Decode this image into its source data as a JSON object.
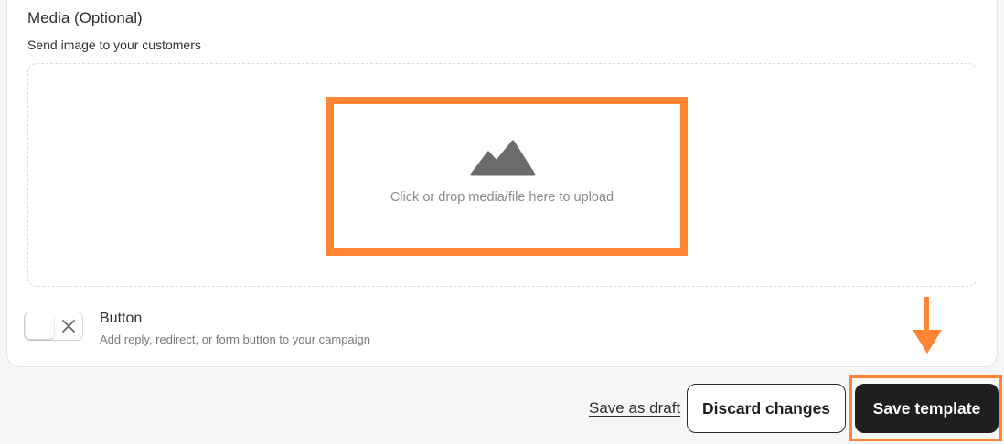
{
  "media": {
    "title": "Media (Optional)",
    "subtitle": "Send image to your customers",
    "dropzone_icon": "image-mountain-icon",
    "dropzone_text": "Click or drop media/file here to upload"
  },
  "button_section": {
    "toggle_state": "off",
    "label": "Button",
    "help_text": "Add reply, redirect, or form button to your campaign"
  },
  "footer": {
    "save_draft_label": "Save as draft",
    "discard_label": "Discard changes",
    "save_label": "Save template"
  },
  "colors": {
    "highlight": "#ff8534",
    "primary_button": "#1f1f1f",
    "background": "#f6f6f6"
  }
}
